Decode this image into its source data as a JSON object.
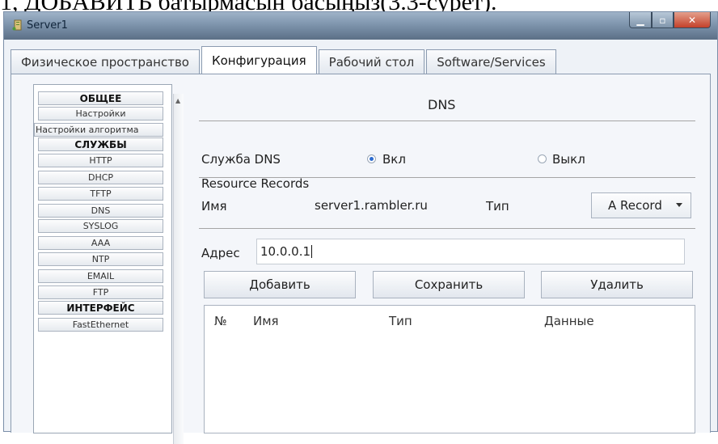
{
  "caption": "1, ДОБАВИТЬ батырмасын басыңыз(3.3-сурет).",
  "window": {
    "title": "Server1"
  },
  "tabs": [
    {
      "label": "Физическое пространство",
      "active": false
    },
    {
      "label": "Конфигурация",
      "active": true
    },
    {
      "label": "Рабочий стол",
      "active": false
    },
    {
      "label": "Software/Services",
      "active": false
    }
  ],
  "sidebar": {
    "items": [
      {
        "label": "ОБЩЕЕ",
        "header": true
      },
      {
        "label": "Настройки",
        "header": false
      },
      {
        "label": "Настройки алгоритма",
        "header": false
      },
      {
        "label": "СЛУЖБЫ",
        "header": true
      },
      {
        "label": "HTTP",
        "header": false
      },
      {
        "label": "DHCP",
        "header": false
      },
      {
        "label": "TFTP",
        "header": false
      },
      {
        "label": "DNS",
        "header": false
      },
      {
        "label": "SYSLOG",
        "header": false
      },
      {
        "label": "AAA",
        "header": false
      },
      {
        "label": "NTP",
        "header": false
      },
      {
        "label": "EMAIL",
        "header": false
      },
      {
        "label": "FTP",
        "header": false
      },
      {
        "label": "ИНТЕРФЕЙС",
        "header": true
      },
      {
        "label": "FastEthernet",
        "header": false
      }
    ]
  },
  "dns": {
    "title": "DNS",
    "service_label": "Служба DNS",
    "on_label": "Вкл",
    "off_label": "Выкл",
    "service_state": "on",
    "resource_records_label": "Resource Records",
    "name_label": "Имя",
    "name_value": "server1.rambler.ru",
    "type_label": "Тип",
    "type_value": "A Record",
    "address_label": "Адрес",
    "address_value": "10.0.0.1",
    "add_button": "Добавить",
    "save_button": "Сохранить",
    "delete_button": "Удалить",
    "table_headers": [
      "№",
      "Имя",
      "Тип",
      "Данные"
    ],
    "table_rows": []
  },
  "colors": {
    "radio_selected": "#2c6bd0",
    "close_button": "#c4412a",
    "titlebar": "#7e95ad"
  }
}
